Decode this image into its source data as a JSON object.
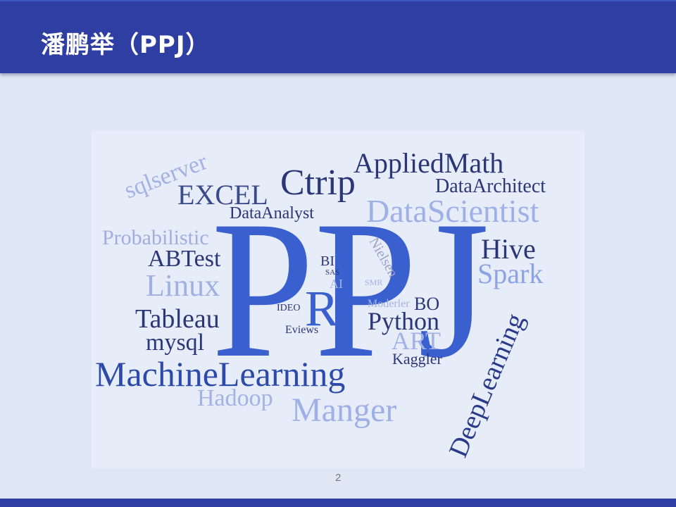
{
  "header": {
    "title": "潘鹏举（PPJ）"
  },
  "word_cloud": {
    "big": "PPJ",
    "words": {
      "sqlserver": "sqlserver",
      "excel": "EXCEL",
      "ctrip": "Ctrip",
      "appliedmath": "AppliedMath",
      "dataarchitect": "DataArchitect",
      "dataanalyst": "DataAnalyst",
      "datascientist": "DataScientist",
      "probabilistic": "Probabilistic",
      "abtest": "ABTest",
      "hive": "Hive",
      "spark": "Spark",
      "linux": "Linux",
      "bi": "BI",
      "sas": "SAS",
      "ai": "AI",
      "nielsen": "Nielsen",
      "smr": "SMR",
      "ideo": "IDEO",
      "r": "R",
      "eviews": "Eviews",
      "moderler": "Moderler",
      "bo": "BO",
      "python": "Python",
      "art": "ART",
      "tableau": "Tableau",
      "mysql": "mysql",
      "kaggler": "Kaggler",
      "machinelearning": "MachineLearning",
      "hadoop": "Hadoop",
      "manger": "Manger",
      "deeplearning": "DeepLearning"
    },
    "colors": {
      "navy": "#2b3677",
      "blue": "#3a5fcf",
      "light": "#a3b2e2",
      "mid": "#2e4aa8"
    }
  },
  "page_number": "2"
}
